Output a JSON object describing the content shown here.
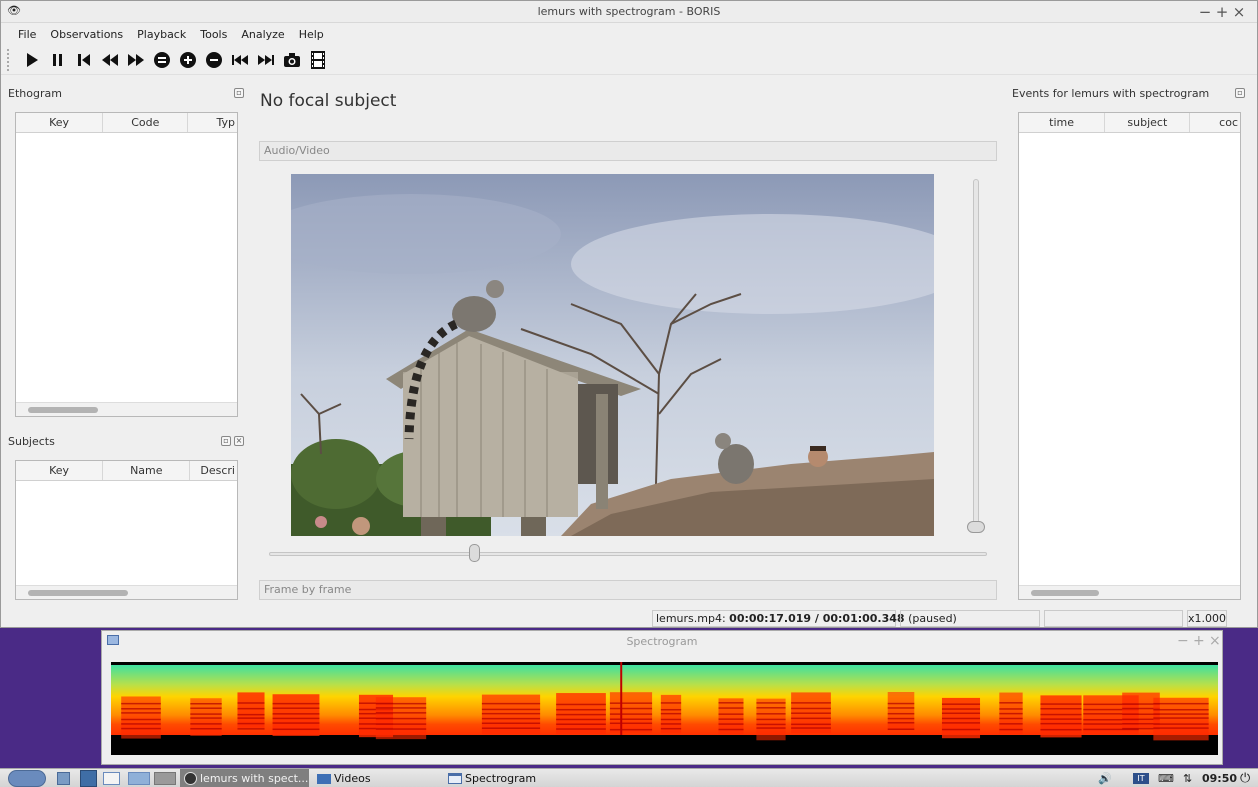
{
  "window": {
    "title": "lemurs with spectrogram - BORIS",
    "controls": {
      "minimize": "−",
      "maximize": "+",
      "close": "×"
    }
  },
  "menubar": [
    "File",
    "Observations",
    "Playback",
    "Tools",
    "Analyze",
    "Help"
  ],
  "toolbar": [
    "play-icon",
    "pause-icon",
    "skip-back-icon",
    "rewind-icon",
    "fast-forward-icon",
    "speed-reset-icon",
    "speed-up-icon",
    "speed-down-icon",
    "previous-media-icon",
    "next-media-icon",
    "snapshot-icon",
    "frame-by-frame-icon"
  ],
  "ethogram": {
    "title": "Ethogram",
    "columns": [
      "Key",
      "Code",
      "Typ"
    ]
  },
  "subjects": {
    "title": "Subjects",
    "columns": [
      "Key",
      "Name",
      "Descri"
    ]
  },
  "focal_subject": "No focal subject",
  "audio_video_label": "Audio/Video",
  "frame_by_frame_label": "Frame by frame",
  "media_progress": 0.285,
  "events": {
    "title": "Events for lemurs with spectrogram",
    "columns": [
      "time",
      "subject",
      "coc"
    ]
  },
  "status": {
    "file": "lemurs.mp4:",
    "time": "00:00:17.019 / 00:01:00.348",
    "state": "(paused)",
    "speed": "x1.000"
  },
  "spectrogram": {
    "title": "Spectrogram",
    "controls": {
      "minimize": "−",
      "maximize": "+",
      "close": "×"
    },
    "cursor_fraction": 0.46
  },
  "taskbar": {
    "items": [
      "lemurs with spect...",
      "Videos",
      "Spectrogram"
    ],
    "clock": "09:50"
  },
  "colors": {
    "desktop": "#4a2a86",
    "spectro_high": "#ff2a00",
    "spectro_mid": "#ffd400",
    "spectro_low": "#3fe0a0"
  }
}
